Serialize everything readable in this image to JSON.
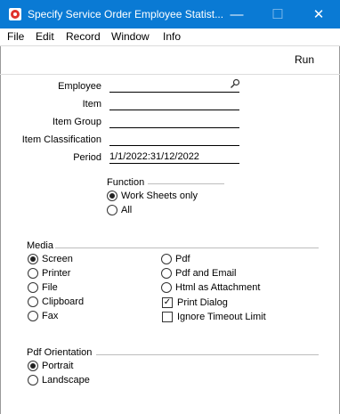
{
  "window": {
    "title": "Specify Service Order Employee Statist...",
    "minimize": "—",
    "maximize": "☐",
    "close": "✕"
  },
  "menu": [
    "File",
    "Edit",
    "Record",
    "Window",
    "Info"
  ],
  "toolbar": {
    "run_label": "Run"
  },
  "form": {
    "employee": {
      "label": "Employee",
      "value": ""
    },
    "item": {
      "label": "Item",
      "value": ""
    },
    "item_group": {
      "label": "Item Group",
      "value": ""
    },
    "item_classification": {
      "label": "Item Classification",
      "value": ""
    },
    "period": {
      "label": "Period",
      "value": "1/1/2022:31/12/2022"
    }
  },
  "function": {
    "title": "Function",
    "options": [
      "Work Sheets only",
      "All"
    ],
    "selected": 0
  },
  "media": {
    "title": "Media",
    "left": [
      "Screen",
      "Printer",
      "File",
      "Clipboard",
      "Fax"
    ],
    "right": [
      "Pdf",
      "Pdf and Email",
      "Html as Attachment"
    ],
    "selected": "Screen",
    "print_dialog_label": "Print Dialog",
    "print_dialog_checked": true,
    "ignore_timeout_label": "Ignore Timeout Limit",
    "ignore_timeout_checked": false
  },
  "orientation": {
    "title": "Pdf Orientation",
    "options": [
      "Portrait",
      "Landscape"
    ],
    "selected": 0
  },
  "colors": {
    "titlebar": "#0a7ad4"
  }
}
